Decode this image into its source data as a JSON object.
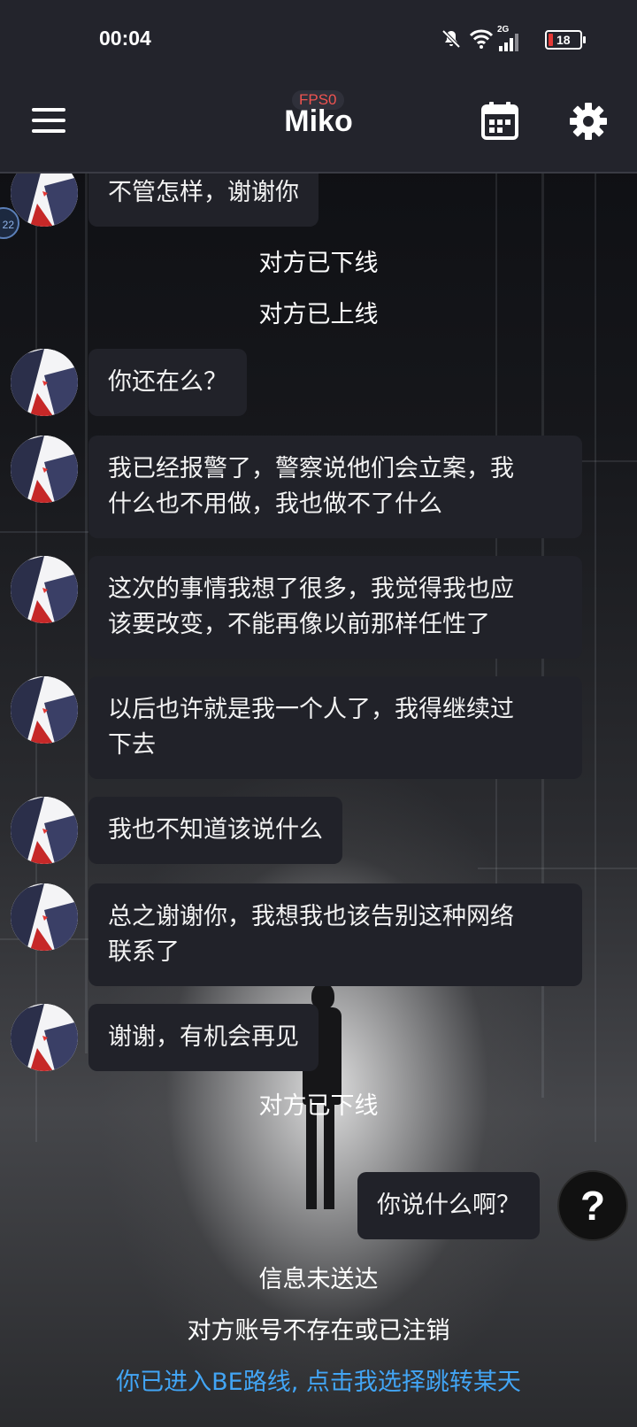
{
  "status_bar": {
    "time": "00:04",
    "network": "2G",
    "battery": "18",
    "icons": [
      "bell-muted-icon",
      "wifi-icon",
      "signal-icon",
      "battery-icon"
    ]
  },
  "app_bar": {
    "title": "Miko",
    "fps_badge": "FPS0",
    "icons": [
      "menu-icon",
      "calendar-icon",
      "gear-icon"
    ]
  },
  "side_badge": "22",
  "messages": [
    {
      "type": "incoming",
      "text": "不管怎样，谢谢你"
    },
    {
      "type": "system",
      "text": "对方已下线"
    },
    {
      "type": "system",
      "text": "对方已上线"
    },
    {
      "type": "incoming",
      "text": "你还在么？"
    },
    {
      "type": "incoming",
      "line1": "我已经报警了，警察说他们会立案，我",
      "line2": "什么也不用做，我也做不了什么"
    },
    {
      "type": "incoming",
      "line1": "这次的事情我想了很多，我觉得我也应",
      "line2": "该要改变，不能再像以前那样任性了"
    },
    {
      "type": "incoming",
      "line1": "以后也许就是我一个人了，我得继续过",
      "line2": "下去"
    },
    {
      "type": "incoming",
      "text": "我也不知道该说什么"
    },
    {
      "type": "incoming",
      "line1": "总之谢谢你，我想我也该告别这种网络",
      "line2": "联系了"
    },
    {
      "type": "incoming",
      "text": "谢谢，有机会再见"
    },
    {
      "type": "system",
      "text": "对方已下线"
    },
    {
      "type": "outgoing",
      "text": "你说什么啊？"
    },
    {
      "type": "system",
      "text": "信息未送达"
    },
    {
      "type": "system",
      "text": "对方账号不存在或已注销"
    },
    {
      "type": "system-link",
      "text": "你已进入BE路线, 点击我选择跳转某天"
    }
  ],
  "help_button": "?",
  "colors": {
    "top_bar": "#23242c",
    "bubble": "#212229",
    "link": "#42a5f5",
    "fps": "#ef5350",
    "battery_low": "#e53935"
  }
}
